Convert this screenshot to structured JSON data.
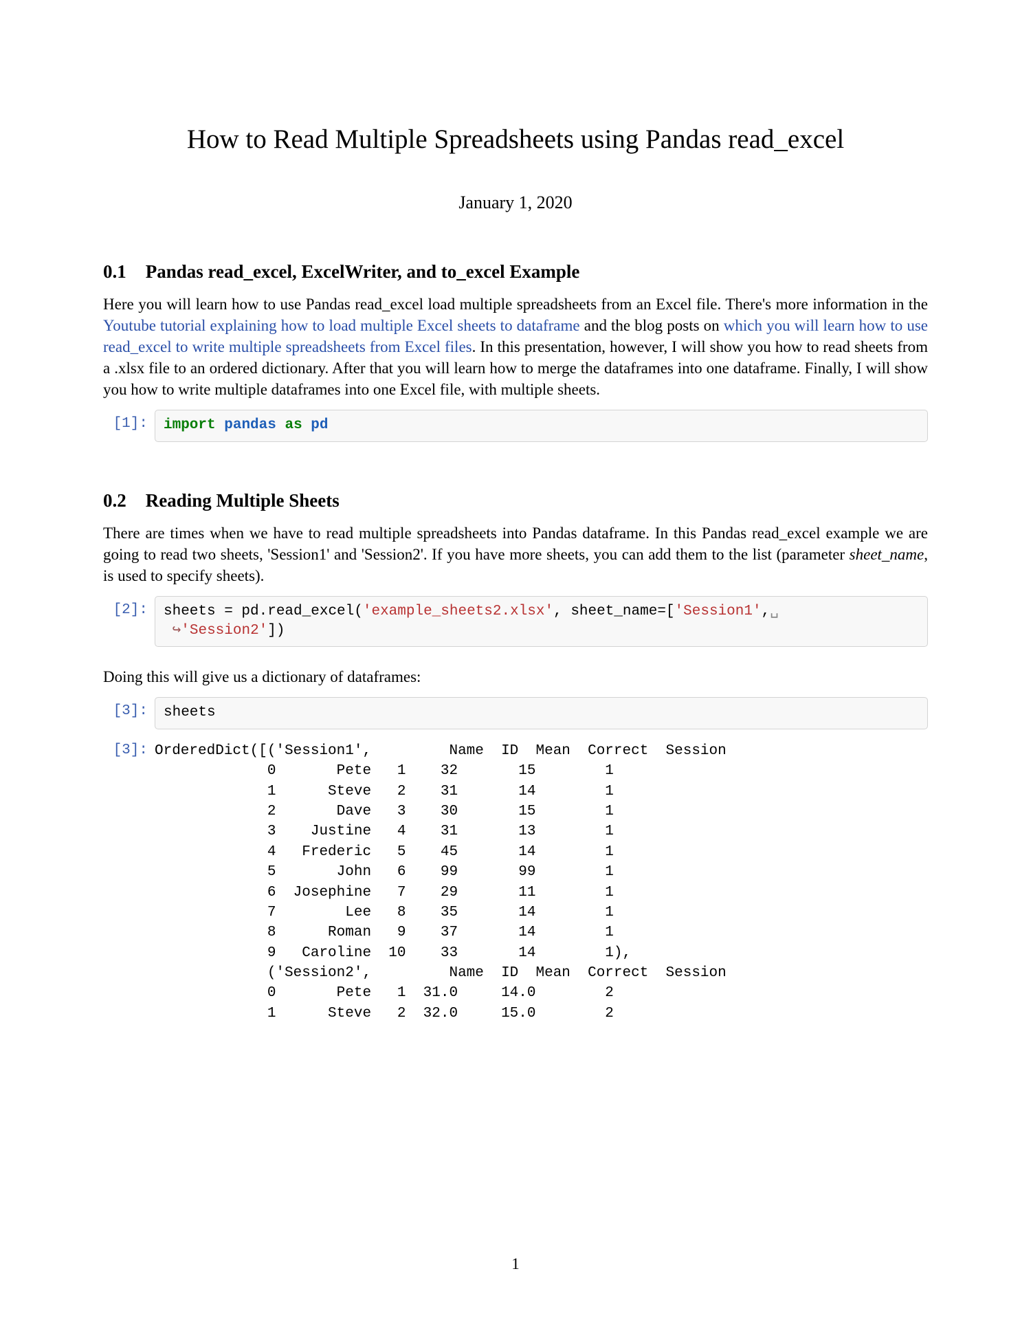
{
  "title": "How to Read Multiple Spreadsheets using Pandas read_excel",
  "date": "January 1, 2020",
  "section1": {
    "num": "0.1",
    "heading": "Pandas read_excel, ExcelWriter, and to_excel Example",
    "p1_part1": "Here you will learn how to use Pandas read_excel load multiple spreadsheets from an Excel file. There's more information in the ",
    "p1_link1": "Youtube tutorial explaining how to load multiple Excel sheets to dataframe",
    "p1_part2": " and the blog posts on ",
    "p1_link2": "which you will learn how to use read_excel to write multiple spreadsheets from Excel files",
    "p1_part3": ". In this presentation, however, I will show you how to read sheets from a .xlsx file to an ordered dictionary. After that you will learn how to merge the dataframes into one dataframe. Finally, I will show you how to write multiple dataframes into one Excel file, with multiple sheets."
  },
  "cell1": {
    "prompt": "[1]:",
    "kw1": "import",
    "kw2": "pandas",
    "kw3": "as",
    "kw4": "pd"
  },
  "section2": {
    "num": "0.2",
    "heading": "Reading Multiple Sheets",
    "p1": "There are times when we have to read multiple spreadsheets into Pandas dataframe. In this Pandas read_excel example we are going to read two sheets, 'Session1' and 'Session2'. If you have more sheets, you can add them to the list (parameter ",
    "p1_italic": "sheet_name",
    "p1_after": ", is used to specify sheets)."
  },
  "cell2": {
    "prompt": "[2]:",
    "line1_a": "sheets = pd.read_excel(",
    "line1_str": "'example_sheets2.xlsx'",
    "line1_b": ", sheet_name=[",
    "line1_str2": "'Session1'",
    "line1_c": ",",
    "line1_sym": "␣",
    "line2_arrow": "↪",
    "line2_str": "'Session2'",
    "line2_end": "])"
  },
  "after_cell2": "Doing this will give us a dictionary of dataframes:",
  "cell3": {
    "prompt": "[3]:",
    "code": "sheets"
  },
  "out3": {
    "prompt": "[3]:",
    "text": "OrderedDict([('Session1',         Name  ID  Mean  Correct  Session\n             0       Pete   1    32       15        1\n             1      Steve   2    31       14        1\n             2       Dave   3    30       15        1\n             3    Justine   4    31       13        1\n             4   Frederic   5    45       14        1\n             5       John   6    99       99        1\n             6  Josephine   7    29       11        1\n             7        Lee   8    35       14        1\n             8      Roman   9    37       14        1\n             9   Caroline  10    33       14        1),\n             ('Session2',         Name  ID  Mean  Correct  Session\n             0       Pete   1  31.0     14.0        2\n             1      Steve   2  32.0     15.0        2"
  },
  "page_number": "1"
}
